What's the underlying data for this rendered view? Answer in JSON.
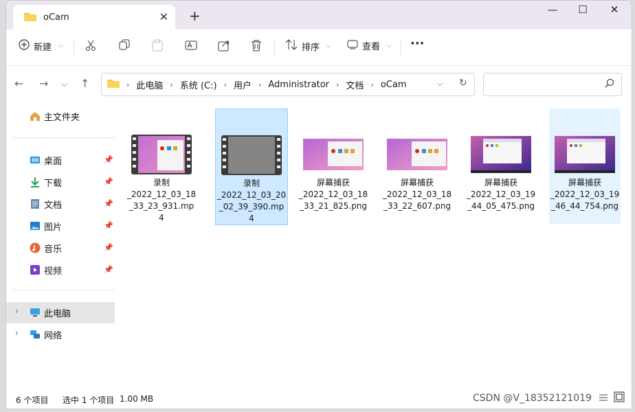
{
  "window": {
    "tab_title": "oCam",
    "new_tab": "+",
    "close_tab": "✕",
    "controls": {
      "minimize": "—",
      "maximize": "☐",
      "close": "✕"
    }
  },
  "toolbar": {
    "new_label": "新建",
    "sort_label": "排序",
    "view_label": "查看",
    "more_label": "···"
  },
  "address": {
    "crumbs": [
      "此电脑",
      "系统 (C:)",
      "用户",
      "Administrator",
      "文档",
      "oCam"
    ],
    "search_placeholder": ""
  },
  "sidebar": {
    "home": "主文件夹",
    "quick": [
      {
        "label": "桌面",
        "icon": "desktop-icon"
      },
      {
        "label": "下载",
        "icon": "download-icon"
      },
      {
        "label": "文档",
        "icon": "documents-icon"
      },
      {
        "label": "图片",
        "icon": "pictures-icon"
      },
      {
        "label": "音乐",
        "icon": "music-icon"
      },
      {
        "label": "视频",
        "icon": "videos-icon"
      }
    ],
    "this_pc": "此电脑",
    "network": "网络"
  },
  "files": [
    {
      "name": "录制\n_2022_12_03_18\n_33_23_931.mp\n4",
      "type": "video"
    },
    {
      "name": "录制\n_2022_12_03_20\n_02_39_390.mp\n4",
      "type": "video"
    },
    {
      "name": "屏幕捕获\n_2022_12_03_18\n_33_21_825.png",
      "type": "image"
    },
    {
      "name": "屏幕捕获\n_2022_12_03_18\n_33_22_607.png",
      "type": "image"
    },
    {
      "name": "屏幕捕获\n_2022_12_03_19\n_44_05_475.png",
      "type": "image"
    },
    {
      "name": "屏幕捕获\n_2022_12_03_19\n_46_44_754.png",
      "type": "image"
    }
  ],
  "status": {
    "count": "6 个项目",
    "selected": "选中 1 个项目",
    "size": "1.00 MB"
  },
  "watermark": "CSDN @V_18352121019",
  "colors": {
    "accent": "#0067c0",
    "selection": "#cde8ff",
    "titlebar": "#ece6f0"
  }
}
